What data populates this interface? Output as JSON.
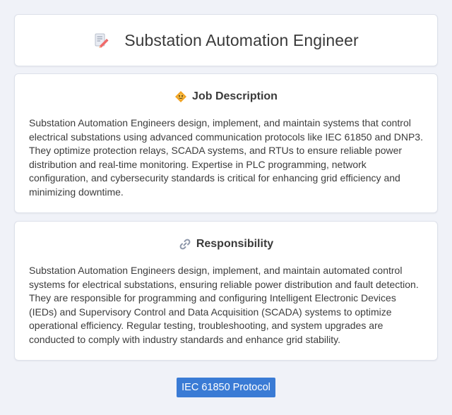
{
  "header": {
    "title": "Substation Automation Engineer",
    "icon": "memo-pencil-icon"
  },
  "job_description": {
    "title": "Job Description",
    "icon": "diamond-badge-icon",
    "body": "Substation Automation Engineers design, implement, and maintain systems that control electrical substations using advanced communication protocols like IEC 61850 and DNP3. They optimize protection relays, SCADA systems, and RTUs to ensure reliable power distribution and real-time monitoring. Expertise in PLC programming, network configuration, and cybersecurity standards is critical for enhancing grid efficiency and minimizing downtime."
  },
  "responsibility": {
    "title": "Responsibility",
    "icon": "link-icon",
    "body": "Substation Automation Engineers design, implement, and maintain automated control systems for electrical substations, ensuring reliable power distribution and fault detection. They are responsible for programming and configuring Intelligent Electronic Devices (IEDs) and Supervisory Control and Data Acquisition (SCADA) systems to optimize operational efficiency. Regular testing, troubleshooting, and system upgrades are conducted to comply with industry standards and enhance grid stability."
  },
  "tags": [
    "IEC 61850 Protocol"
  ],
  "colors": {
    "background": "#f0f2f8",
    "card": "#ffffff",
    "tag": "#3a7bd5"
  }
}
